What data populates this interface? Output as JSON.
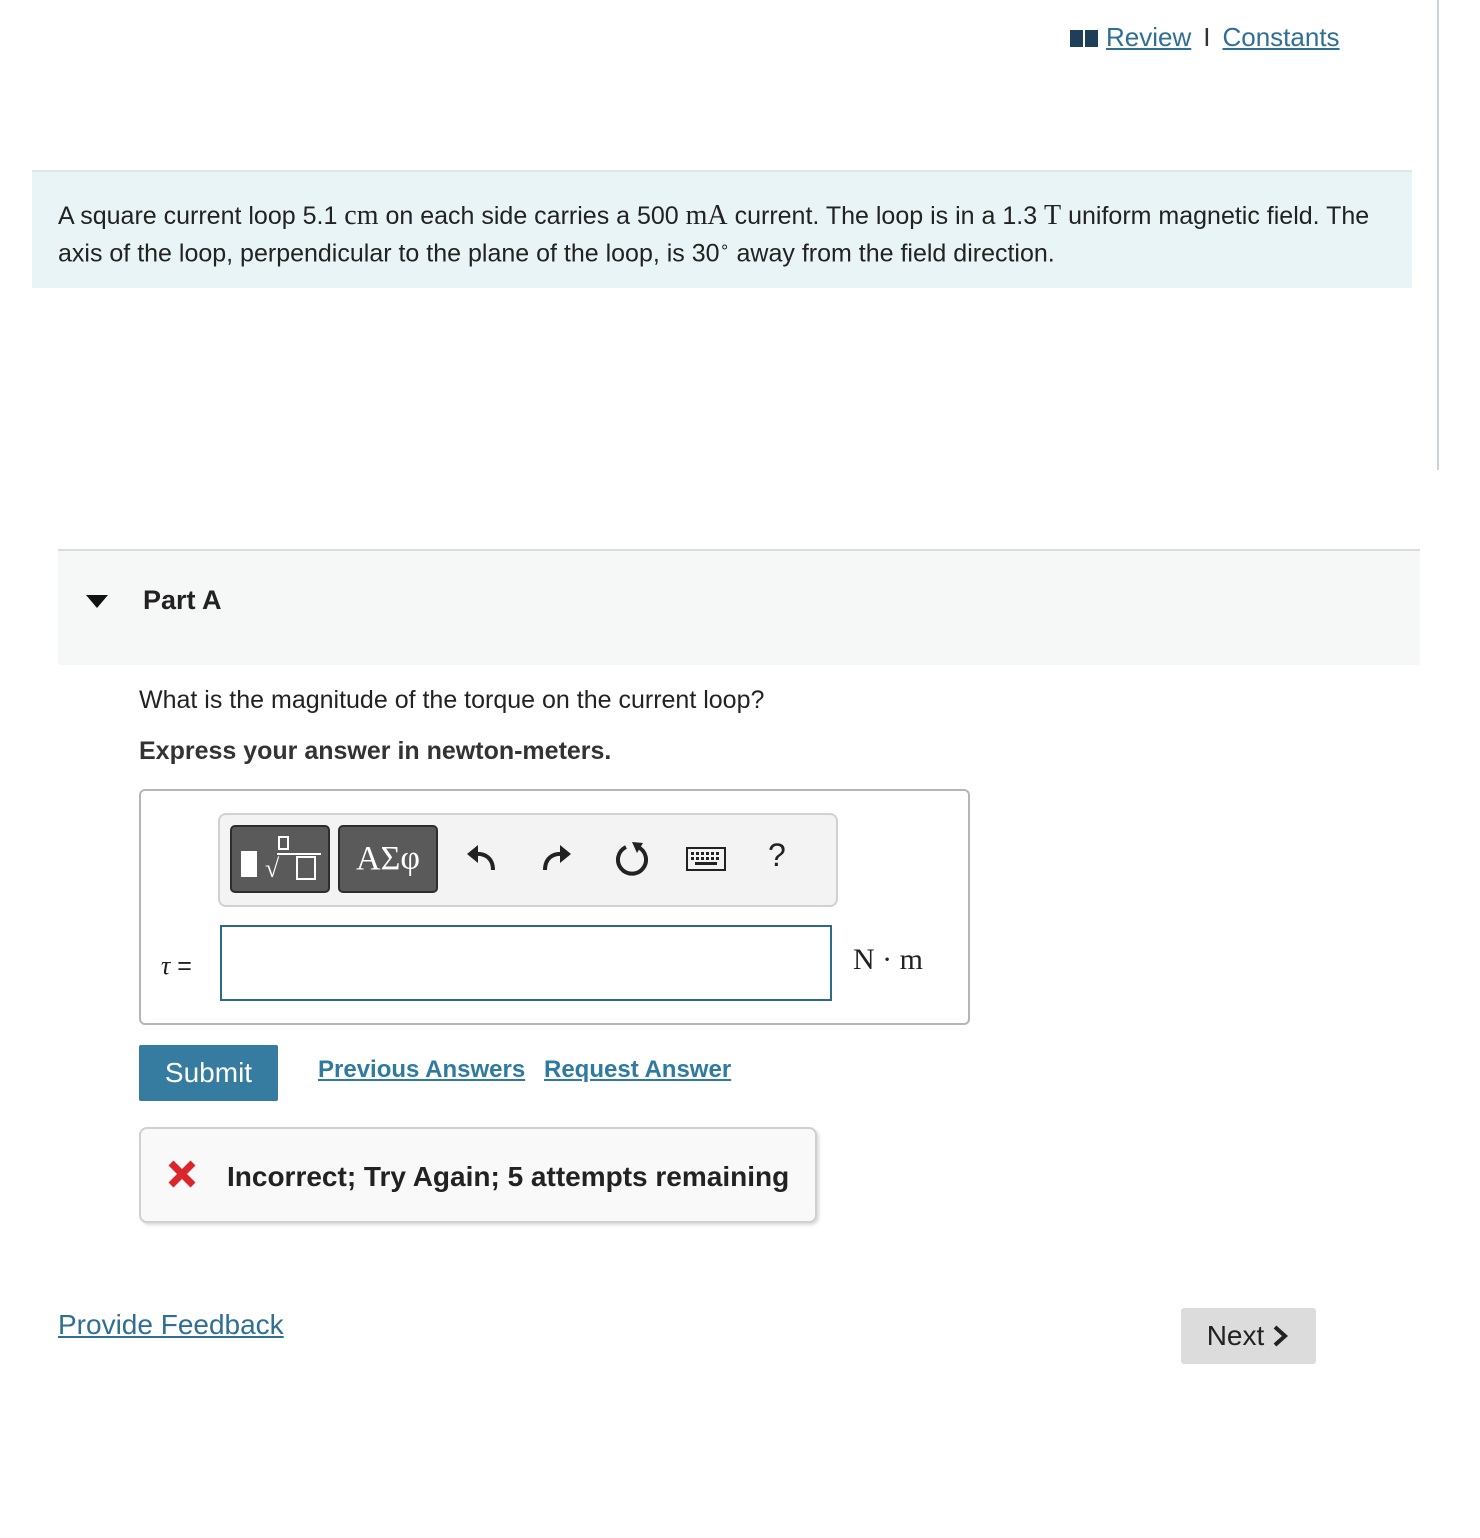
{
  "top_links": {
    "review": "Review",
    "separator": "I",
    "constants": "Constants"
  },
  "problem": {
    "t1": "A square current loop 5.1 ",
    "u1": "cm",
    "t2": " on each side carries a 500 ",
    "u2": "mA",
    "t3": " current. The loop is in a 1.3 ",
    "u3": "T",
    "t4": " uniform magnetic field. The axis of the loop, perpendicular to the plane of the loop, is 30",
    "deg": "∘",
    "t5": " away from the field direction."
  },
  "part": {
    "title": "Part A",
    "question": "What is the magnitude of the torque on the current loop?",
    "instruction": "Express your answer in newton-meters."
  },
  "toolbar": {
    "greek_label": "ΑΣφ",
    "help_label": "?"
  },
  "answer": {
    "variable": "τ",
    "equals": " =",
    "value": "",
    "units": "N · m"
  },
  "actions": {
    "submit": "Submit",
    "previous_answers": "Previous Answers",
    "request_answer": "Request Answer"
  },
  "feedback": {
    "message": "Incorrect; Try Again; 5 attempts remaining"
  },
  "footer": {
    "provide_feedback": "Provide Feedback",
    "next": "Next"
  },
  "colors": {
    "accent": "#367ba0",
    "link": "#2e6f93",
    "error": "#d9262a",
    "problem_bg": "#e9f4f6"
  }
}
